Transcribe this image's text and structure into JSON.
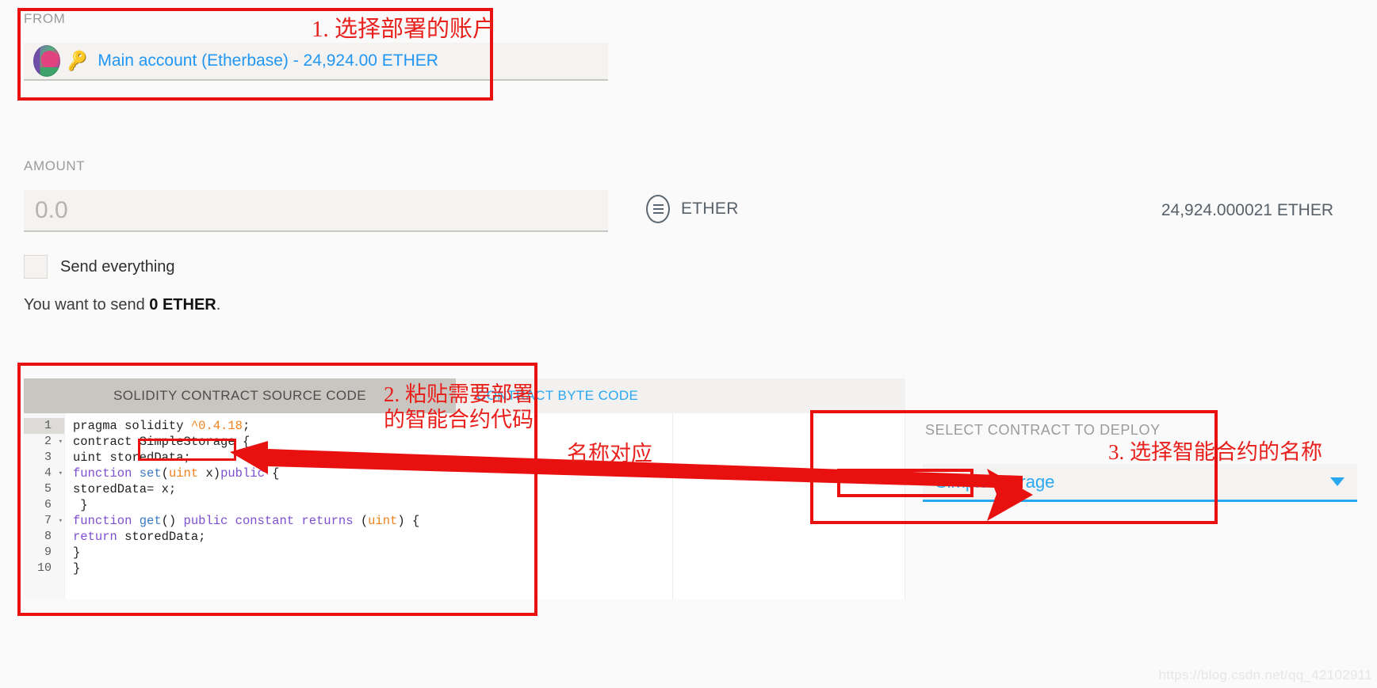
{
  "from": {
    "label": "FROM",
    "account_text": "Main account (Etherbase) - 24,924.00 ETHER",
    "identicon_name": "account-identicon",
    "key_glyph": "🔑"
  },
  "amount": {
    "label": "AMOUNT",
    "input_value": "",
    "input_placeholder": "0.0",
    "unit_label": "ETHER",
    "balance_text": "24,924.000021 ETHER",
    "send_everything_label": "Send everything",
    "send_everything_checked": false,
    "summary_prefix": "You want to send ",
    "summary_amount": "0 ETHER",
    "summary_suffix": "."
  },
  "code_panel": {
    "tabs": [
      {
        "label": "SOLIDITY CONTRACT SOURCE CODE",
        "active": true
      },
      {
        "label": "CONTRACT BYTE CODE",
        "active": false
      }
    ],
    "line_numbers": [
      "1",
      "2",
      "3",
      "4",
      "5",
      "6",
      "7",
      "8",
      "9",
      "10"
    ],
    "fold_markers": [
      "",
      "▾",
      "",
      "▾",
      "",
      "",
      "▾",
      "",
      "",
      ""
    ],
    "lines": [
      [
        {
          "t": "pragma solidity ",
          "c": "def"
        },
        {
          "t": "^0.4.18",
          "c": "num"
        },
        {
          "t": ";",
          "c": "def"
        }
      ],
      [
        {
          "t": "contract ",
          "c": "def"
        },
        {
          "t": "SimpleStorage",
          "c": "def"
        },
        {
          "t": " {",
          "c": "def"
        }
      ],
      [
        {
          "t": "uint storedData;",
          "c": "def"
        }
      ],
      [
        {
          "t": "function ",
          "c": "kw"
        },
        {
          "t": "set",
          "c": "fn"
        },
        {
          "t": "(",
          "c": "def"
        },
        {
          "t": "uint",
          "c": "type"
        },
        {
          "t": " x)",
          "c": "def"
        },
        {
          "t": "public",
          "c": "kw"
        },
        {
          "t": " {",
          "c": "def"
        }
      ],
      [
        {
          "t": "storedData= x;",
          "c": "def"
        }
      ],
      [
        {
          "t": " }",
          "c": "def"
        }
      ],
      [
        {
          "t": "function ",
          "c": "kw"
        },
        {
          "t": "get",
          "c": "fn"
        },
        {
          "t": "() ",
          "c": "def"
        },
        {
          "t": "public",
          "c": "kw"
        },
        {
          "t": " ",
          "c": "def"
        },
        {
          "t": "constant",
          "c": "kw"
        },
        {
          "t": " ",
          "c": "def"
        },
        {
          "t": "returns",
          "c": "kw"
        },
        {
          "t": " (",
          "c": "def"
        },
        {
          "t": "uint",
          "c": "type"
        },
        {
          "t": ") {",
          "c": "def"
        }
      ],
      [
        {
          "t": "return",
          "c": "kw"
        },
        {
          "t": " storedData;",
          "c": "def"
        }
      ],
      [
        {
          "t": "}",
          "c": "def"
        }
      ],
      [
        {
          "t": "}",
          "c": "def"
        }
      ]
    ]
  },
  "deploy": {
    "label": "SELECT CONTRACT TO DEPLOY",
    "selected_contract": "Simple Storage",
    "arrow_icon": "chevron-down-icon"
  },
  "annotations": {
    "step1": "1. 选择部署的账户",
    "step2": "2. 粘贴需要部署\n的智能合约代码",
    "step3": "3. 选择智能合约的名称",
    "match": "名称对应",
    "color": "#e8201c"
  },
  "watermark": "https://blog.csdn.net/qq_42102911"
}
